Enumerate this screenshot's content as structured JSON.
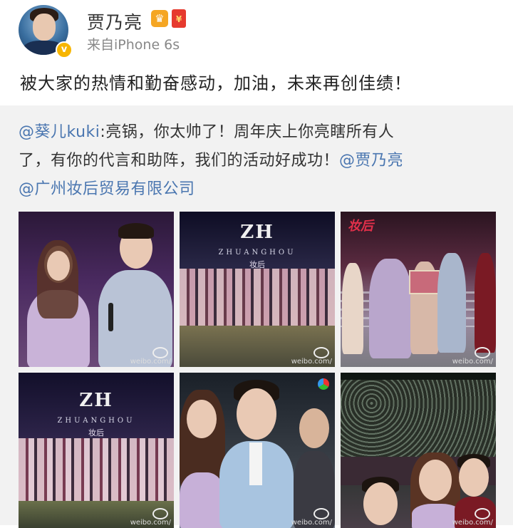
{
  "user": {
    "name": "贾乃亮",
    "source": "来自iPhone 6s",
    "badge_colors": {
      "verified": "#f7b500",
      "crown": "#f5a623",
      "red_packet": "#e63a2e"
    }
  },
  "post": {
    "text": "被大家的热情和勤奋感动，加油，未来再创佳绩！"
  },
  "repost": {
    "author": "@葵儿kuki",
    "line1": ":亮锅，你太帅了！周年庆上你亮瞎所有人",
    "line2": "了，有你的代言和助阵，我们的活动好成功！",
    "mention1": "@贾乃亮",
    "mention2": "@广州妆后贸易有限公司",
    "link_color": "#4a76b0"
  },
  "photos": {
    "logo_zh": "ZH",
    "logo_word": "ZHUANGHOU",
    "logo_cn": "妆后",
    "watermark": "weibo.com/"
  }
}
